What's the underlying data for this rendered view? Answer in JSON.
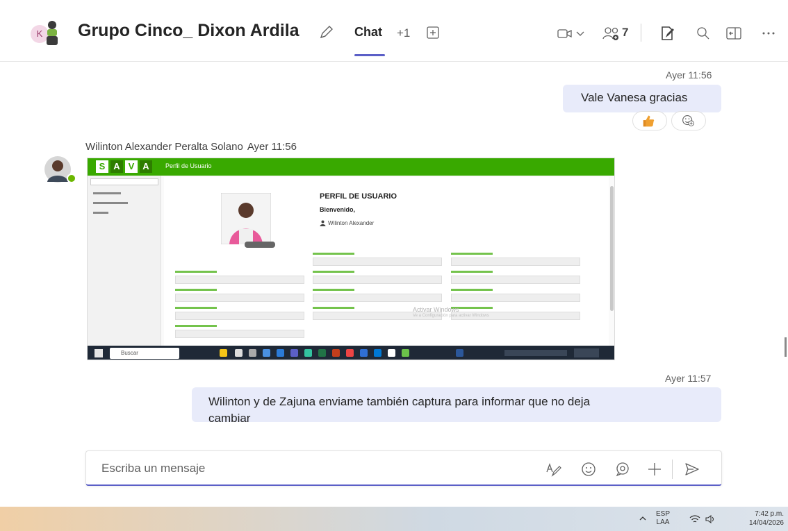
{
  "header": {
    "avatar_letter": "K",
    "title": "Grupo Cinco_ Dixon Ardila",
    "tab_chat": "Chat",
    "tab_more": "+1",
    "participants_count": "7"
  },
  "messages": [
    {
      "time": "Ayer 11:56",
      "text": "Vale Vanesa gracias"
    },
    {
      "sender": "Wilinton Alexander Peralta Solano",
      "time": "Ayer 11:56"
    },
    {
      "time": "Ayer 11:57",
      "text_line1": "Wilinton y de Zajuna enviame también captura para informar que no deja",
      "text_line2": "cambiar"
    }
  ],
  "attachment": {
    "logo_letters": [
      "S",
      "A",
      "V",
      "A"
    ],
    "section": "Perfil de Usuario",
    "page_title": "PERFIL DE USUARIO",
    "welcome": "Bienvenido,",
    "user_name": "Wilinton Alexander",
    "watermark_line1": "Activar Windows",
    "watermark_line2": "Ve a Configuración para activar Windows",
    "taskbar_search": "Buscar"
  },
  "compose": {
    "placeholder": "Escriba un mensaje"
  },
  "taskbar": {
    "lang_line1": "ESP",
    "lang_line2": "LAA",
    "time": "7:42 p.m.",
    "date": "14/04/2026"
  },
  "colors": {
    "accent": "#5b5fc7",
    "bubble": "#e8ebfa",
    "sava_green": "#39a900"
  }
}
